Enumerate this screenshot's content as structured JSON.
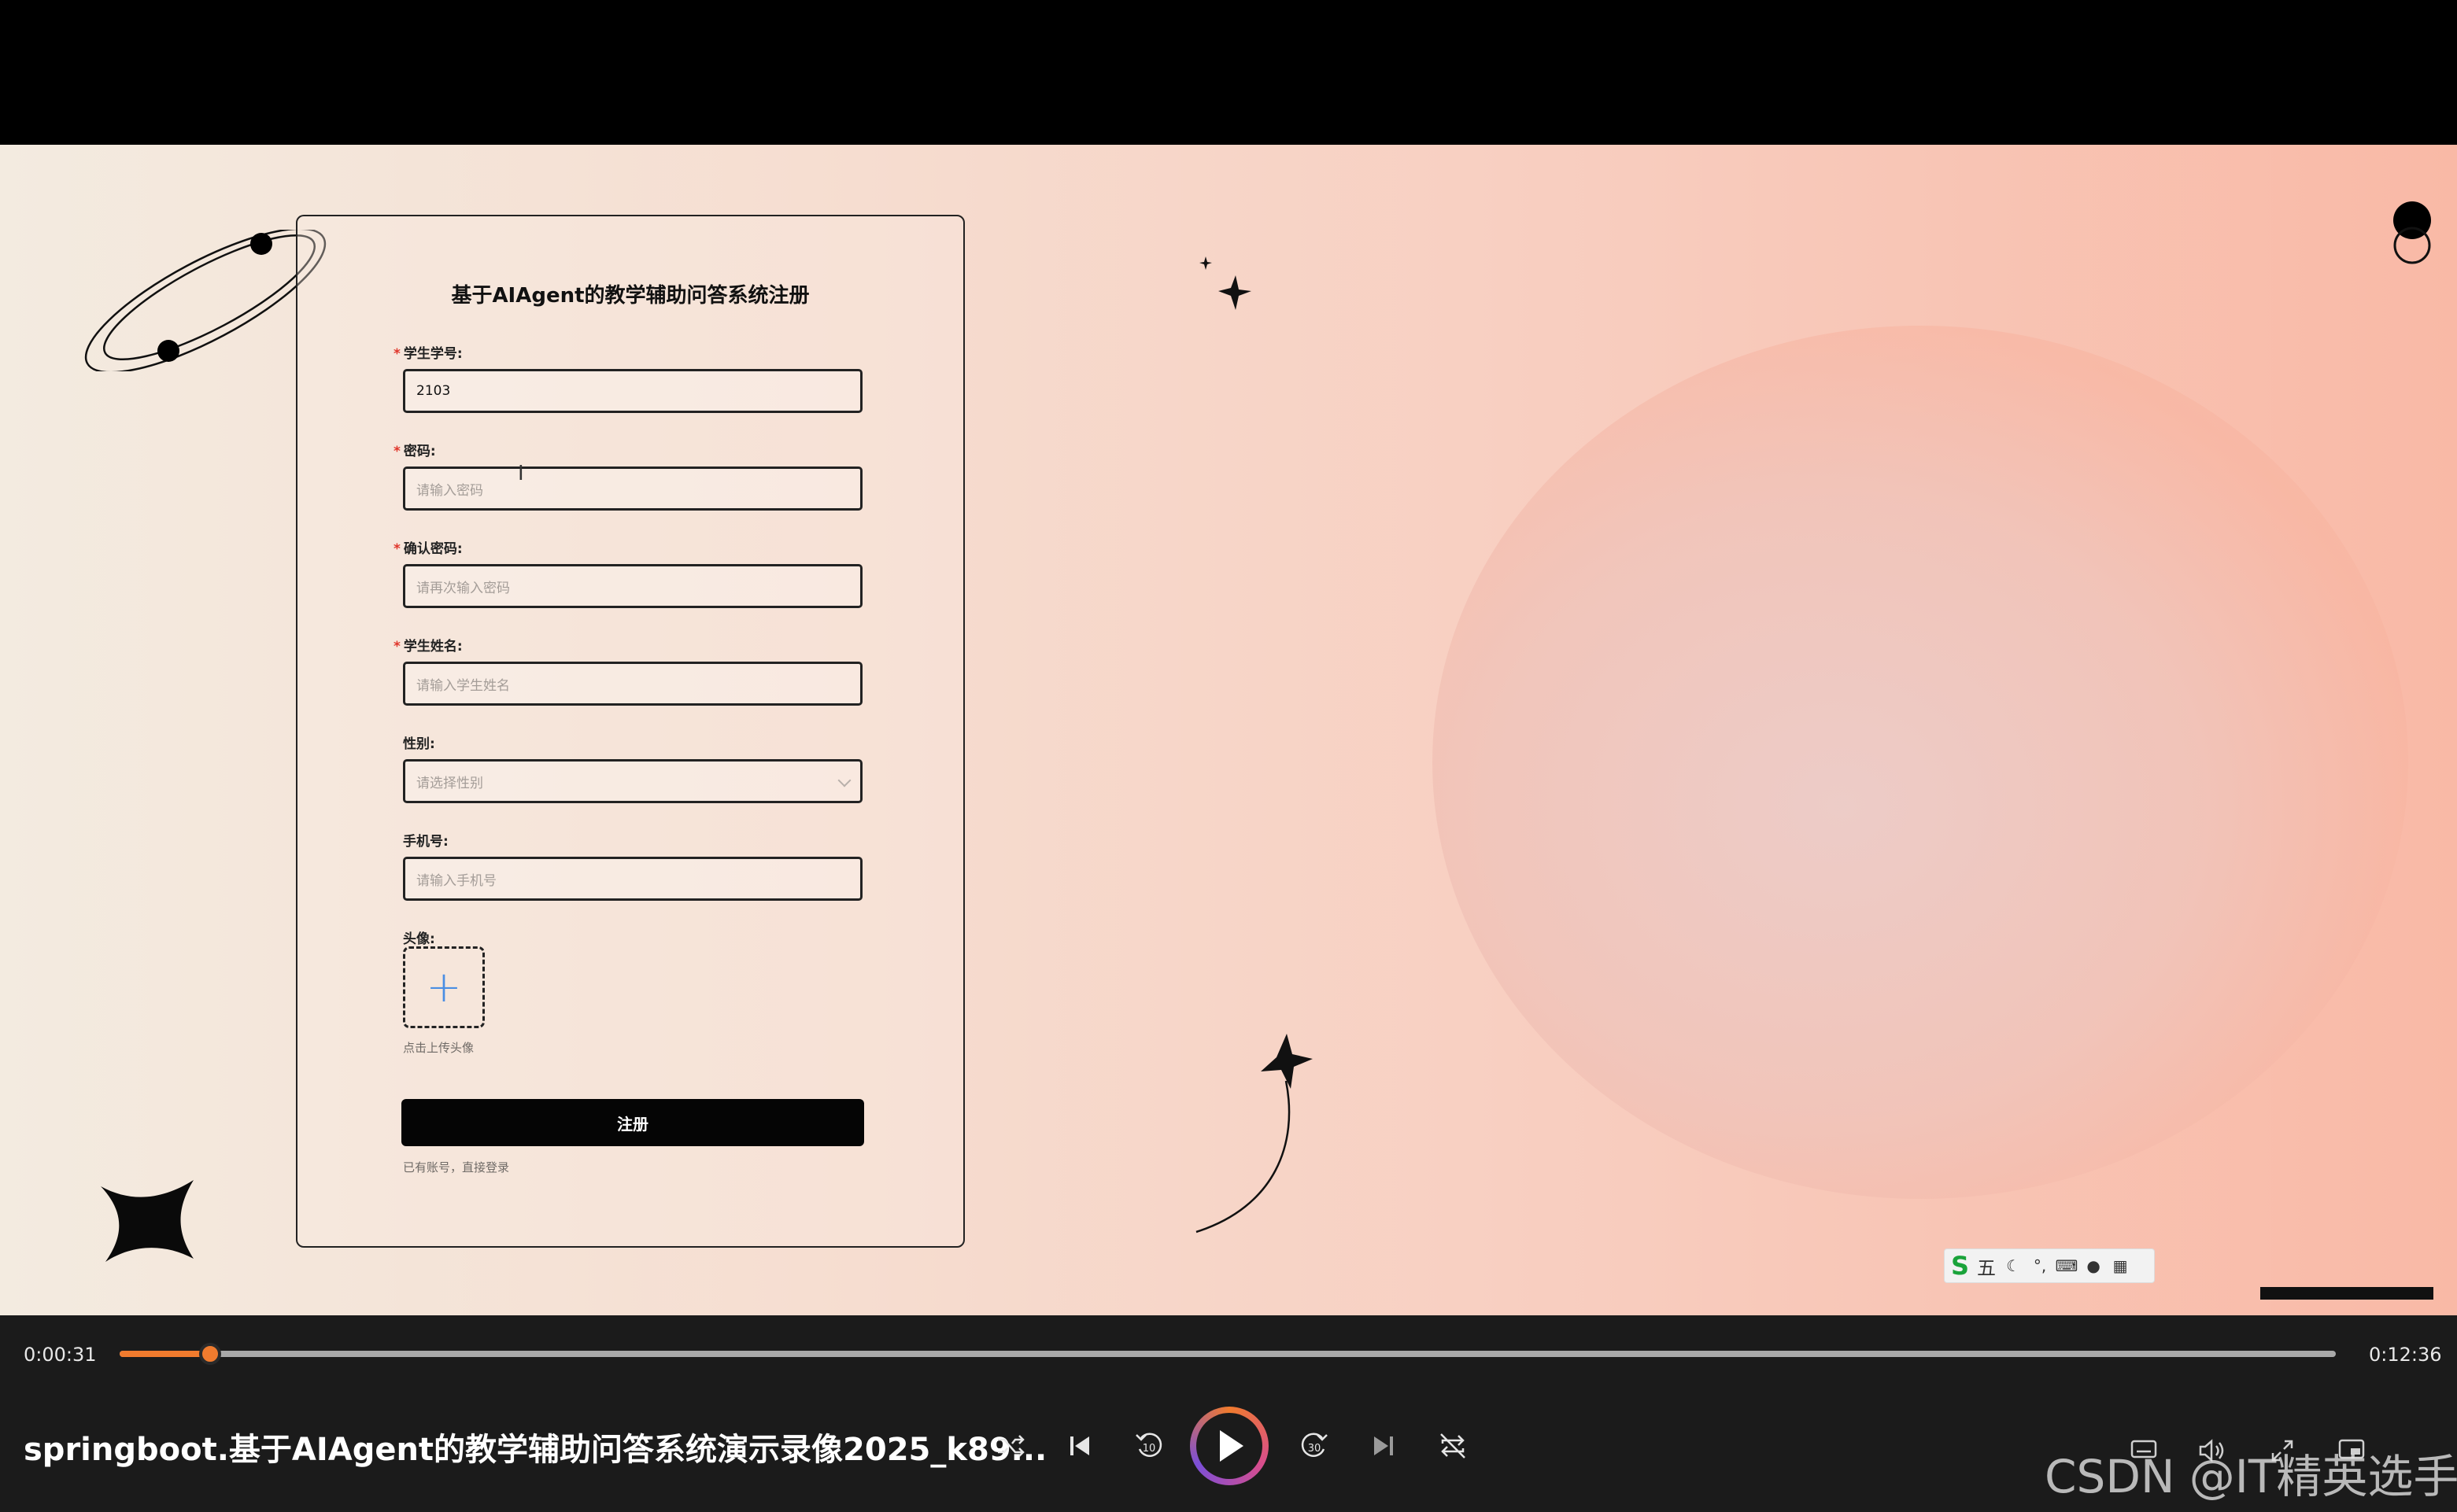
{
  "form": {
    "title": "基于AIAgent的教学辅助问答系统注册",
    "required_mark": "*",
    "fields": {
      "student_id": {
        "label": "学生学号:",
        "value": "2103"
      },
      "password": {
        "label": "密码:",
        "placeholder": "请输入密码"
      },
      "confirm_password": {
        "label": "确认密码:",
        "placeholder": "请再次输入密码"
      },
      "student_name": {
        "label": "学生姓名:",
        "placeholder": "请输入学生姓名"
      },
      "gender": {
        "label": "性别:",
        "placeholder": "请选择性别"
      },
      "phone": {
        "label": "手机号:",
        "placeholder": "请输入手机号"
      },
      "avatar": {
        "label": "头像:",
        "hint": "点击上传头像",
        "icon": "plus-icon"
      }
    },
    "register_button": "注册",
    "login_link": "已有账号，直接登录"
  },
  "ime": {
    "logo": "S",
    "mode": "五",
    "icons": [
      "moon-icon",
      "punctuation-icon",
      "keyboard-icon",
      "user-icon",
      "apps-icon"
    ]
  },
  "player": {
    "current_time": "0:00:31",
    "total_time": "0:12:36",
    "progress": 0.041,
    "title": "springboot.基于AIAgent的教学辅助问答系统演示录像2025_k89...",
    "skip_back": "10",
    "skip_forward": "30",
    "accent": "#f07b2e",
    "controls": [
      "shuffle-icon",
      "previous-icon",
      "rewind-10-icon",
      "play-icon",
      "forward-30-icon",
      "next-icon",
      "repeat-off-icon"
    ],
    "right_controls": [
      "subtitles-icon",
      "volume-icon",
      "fullscreen-icon",
      "miniplayer-icon"
    ]
  },
  "watermark": "CSDN @IT精英选手"
}
